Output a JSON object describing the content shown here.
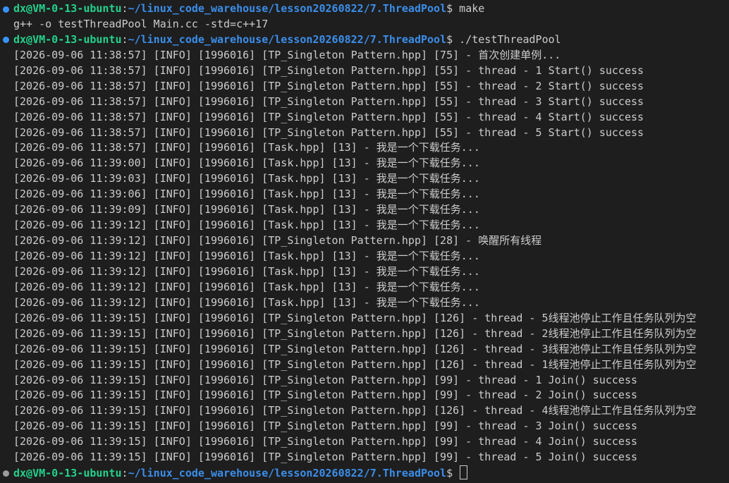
{
  "terminal": {
    "prompt": {
      "user_host": "dx@VM-0-13-ubuntu",
      "separator": ":",
      "path": "~/linux_code_warehouse/lesson20260822/7.ThreadPool",
      "symbol": "$ "
    },
    "lines": [
      {
        "kind": "prompt",
        "command": "make",
        "marker": "done"
      },
      {
        "kind": "output",
        "text": "g++ -o testThreadPool Main.cc -std=c++17"
      },
      {
        "kind": "prompt",
        "command": "./testThreadPool",
        "marker": "done"
      },
      {
        "kind": "output",
        "text": "[2026-09-06 11:38:57] [INFO] [1996016] [TP_Singleton Pattern.hpp] [75] - 首次创建单例..."
      },
      {
        "kind": "output",
        "text": "[2026-09-06 11:38:57] [INFO] [1996016] [TP_Singleton Pattern.hpp] [55] - thread - 1 Start() success"
      },
      {
        "kind": "output",
        "text": "[2026-09-06 11:38:57] [INFO] [1996016] [TP_Singleton Pattern.hpp] [55] - thread - 2 Start() success"
      },
      {
        "kind": "output",
        "text": "[2026-09-06 11:38:57] [INFO] [1996016] [TP_Singleton Pattern.hpp] [55] - thread - 3 Start() success"
      },
      {
        "kind": "output",
        "text": "[2026-09-06 11:38:57] [INFO] [1996016] [TP_Singleton Pattern.hpp] [55] - thread - 4 Start() success"
      },
      {
        "kind": "output",
        "text": "[2026-09-06 11:38:57] [INFO] [1996016] [TP_Singleton Pattern.hpp] [55] - thread - 5 Start() success"
      },
      {
        "kind": "output",
        "text": "[2026-09-06 11:38:57] [INFO] [1996016] [Task.hpp] [13] - 我是一个下载任务..."
      },
      {
        "kind": "output",
        "text": "[2026-09-06 11:39:00] [INFO] [1996016] [Task.hpp] [13] - 我是一个下载任务..."
      },
      {
        "kind": "output",
        "text": "[2026-09-06 11:39:03] [INFO] [1996016] [Task.hpp] [13] - 我是一个下载任务..."
      },
      {
        "kind": "output",
        "text": "[2026-09-06 11:39:06] [INFO] [1996016] [Task.hpp] [13] - 我是一个下载任务..."
      },
      {
        "kind": "output",
        "text": "[2026-09-06 11:39:09] [INFO] [1996016] [Task.hpp] [13] - 我是一个下载任务..."
      },
      {
        "kind": "output",
        "text": "[2026-09-06 11:39:12] [INFO] [1996016] [Task.hpp] [13] - 我是一个下载任务..."
      },
      {
        "kind": "output",
        "text": "[2026-09-06 11:39:12] [INFO] [1996016] [TP_Singleton Pattern.hpp] [28] - 唤醒所有线程"
      },
      {
        "kind": "output",
        "text": "[2026-09-06 11:39:12] [INFO] [1996016] [Task.hpp] [13] - 我是一个下载任务..."
      },
      {
        "kind": "output",
        "text": "[2026-09-06 11:39:12] [INFO] [1996016] [Task.hpp] [13] - 我是一个下载任务..."
      },
      {
        "kind": "output",
        "text": "[2026-09-06 11:39:12] [INFO] [1996016] [Task.hpp] [13] - 我是一个下载任务..."
      },
      {
        "kind": "output",
        "text": "[2026-09-06 11:39:12] [INFO] [1996016] [Task.hpp] [13] - 我是一个下载任务..."
      },
      {
        "kind": "output",
        "text": "[2026-09-06 11:39:15] [INFO] [1996016] [TP_Singleton Pattern.hpp] [126] - thread - 5线程池停止工作且任务队列为空"
      },
      {
        "kind": "output",
        "text": "[2026-09-06 11:39:15] [INFO] [1996016] [TP_Singleton Pattern.hpp] [126] - thread - 2线程池停止工作且任务队列为空"
      },
      {
        "kind": "output",
        "text": "[2026-09-06 11:39:15] [INFO] [1996016] [TP_Singleton Pattern.hpp] [126] - thread - 3线程池停止工作且任务队列为空"
      },
      {
        "kind": "output",
        "text": "[2026-09-06 11:39:15] [INFO] [1996016] [TP_Singleton Pattern.hpp] [126] - thread - 1线程池停止工作且任务队列为空"
      },
      {
        "kind": "output",
        "text": "[2026-09-06 11:39:15] [INFO] [1996016] [TP_Singleton Pattern.hpp] [99] - thread - 1 Join() success"
      },
      {
        "kind": "output",
        "text": "[2026-09-06 11:39:15] [INFO] [1996016] [TP_Singleton Pattern.hpp] [99] - thread - 2 Join() success"
      },
      {
        "kind": "output",
        "text": "[2026-09-06 11:39:15] [INFO] [1996016] [TP_Singleton Pattern.hpp] [126] - thread - 4线程池停止工作且任务队列为空"
      },
      {
        "kind": "output",
        "text": "[2026-09-06 11:39:15] [INFO] [1996016] [TP_Singleton Pattern.hpp] [99] - thread - 3 Join() success"
      },
      {
        "kind": "output",
        "text": "[2026-09-06 11:39:15] [INFO] [1996016] [TP_Singleton Pattern.hpp] [99] - thread - 4 Join() success"
      },
      {
        "kind": "output",
        "text": "[2026-09-06 11:39:15] [INFO] [1996016] [TP_Singleton Pattern.hpp] [99] - thread - 5 Join() success"
      },
      {
        "kind": "prompt",
        "command": "",
        "marker": "idle",
        "cursor": true
      }
    ]
  },
  "colors": {
    "background": "#1e1e1e",
    "text": "#cccccc",
    "user_host": "#23d18b",
    "path": "#3b8eea",
    "command_marker": "#3794ff",
    "idle_marker": "#9b9b9b"
  }
}
